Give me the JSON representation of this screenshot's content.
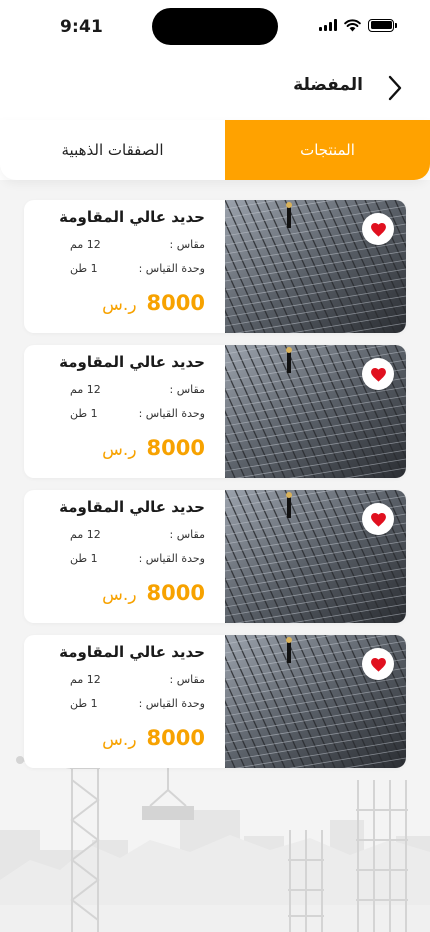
{
  "status_bar": {
    "time": "9:41"
  },
  "header": {
    "title": "المفضلة"
  },
  "tabs": [
    {
      "label": "المنتجات",
      "active": true
    },
    {
      "label": "الصفقات الذهبية",
      "active": false
    }
  ],
  "colors": {
    "accent": "#ffa200",
    "price": "#f7a200",
    "favorite": "#e0101f"
  },
  "products": [
    {
      "name": "حديد عالي المقاومة",
      "size_label": "مقاس :",
      "size_value": "12 مم",
      "unit_label": "وحدة القياس :",
      "unit_value": "1 طن",
      "price": "8000",
      "currency": "ر.س",
      "favorited": true
    },
    {
      "name": "حديد عالي المقاومة",
      "size_label": "مقاس :",
      "size_value": "12 مم",
      "unit_label": "وحدة القياس :",
      "unit_value": "1 طن",
      "price": "8000",
      "currency": "ر.س",
      "favorited": true
    },
    {
      "name": "حديد عالي المقاومة",
      "size_label": "مقاس :",
      "size_value": "12 مم",
      "unit_label": "وحدة القياس :",
      "unit_value": "1 طن",
      "price": "8000",
      "currency": "ر.س",
      "favorited": true
    },
    {
      "name": "حديد عالي المقاومة",
      "size_label": "مقاس :",
      "size_value": "12 مم",
      "unit_label": "وحدة القياس :",
      "unit_value": "1 طن",
      "price": "8000",
      "currency": "ر.س",
      "favorited": true
    }
  ],
  "icons": {
    "back": "chevron-right-icon",
    "favorite": "heart-icon"
  }
}
